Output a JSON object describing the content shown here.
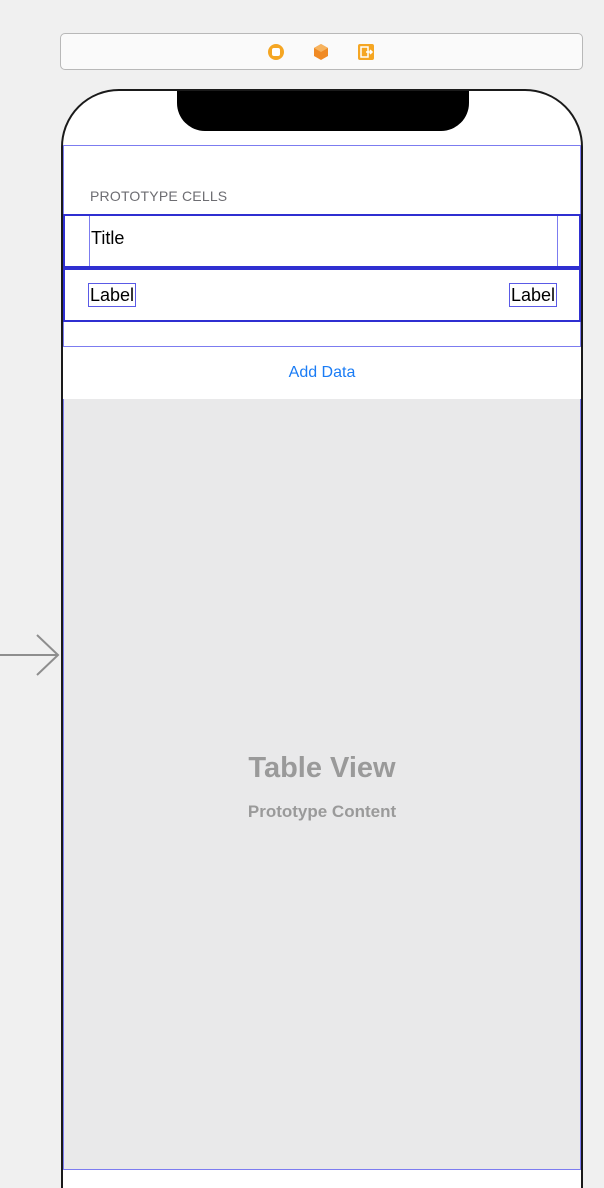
{
  "scene_dock": {
    "icons": [
      "view-controller-icon",
      "first-responder-icon",
      "exit-icon"
    ],
    "icon_color": "#f5a623"
  },
  "table": {
    "section_header": "PROTOTYPE CELLS",
    "title_cell_label": "Title",
    "detail_left_label": "Label",
    "detail_right_label": "Label",
    "footer_button": "Add Data",
    "placeholder_title": "Table View",
    "placeholder_subtitle": "Prototype Content"
  },
  "colors": {
    "selection_outline": "#2f2fd1",
    "constraint_outline": "#7c7cf0",
    "link_blue": "#1a7cf5",
    "placeholder_text": "#9a9a9a"
  }
}
